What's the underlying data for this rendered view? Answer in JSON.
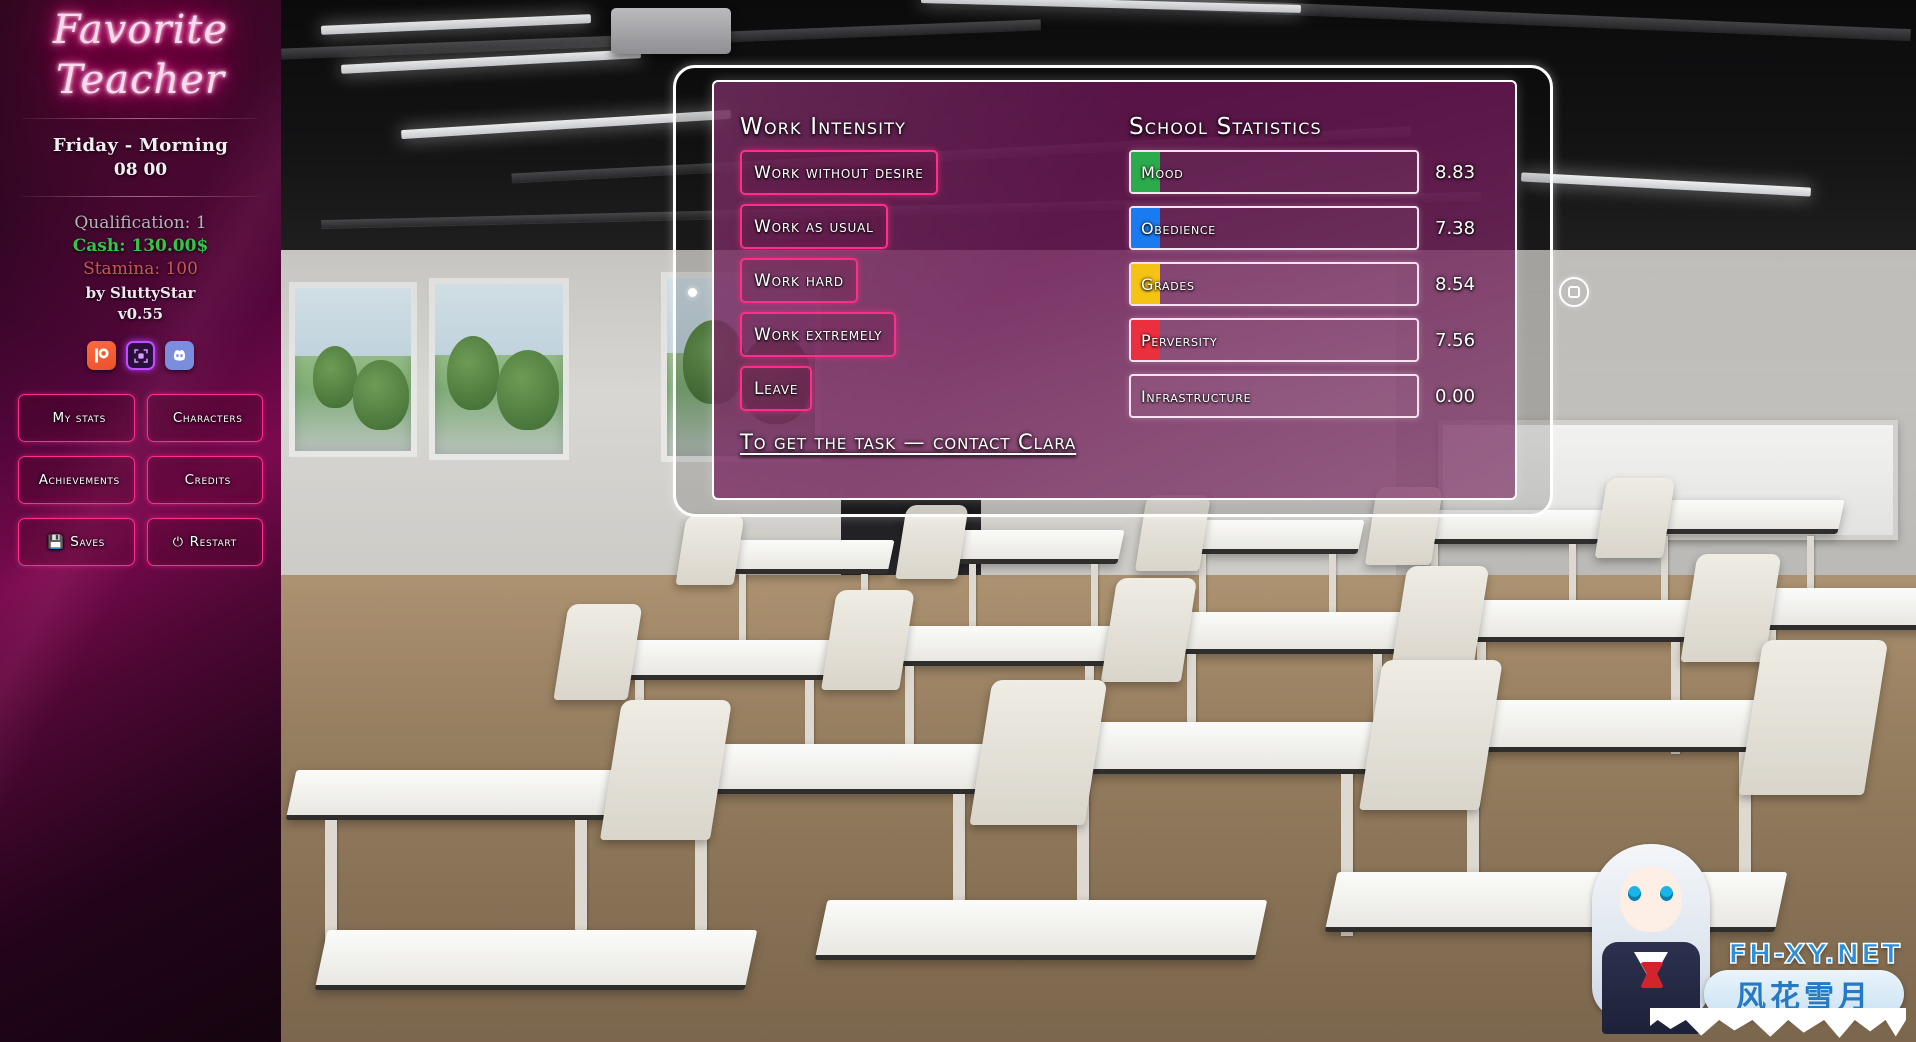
{
  "sidebar": {
    "title_line1": "Favorite",
    "title_line2": "Teacher",
    "day_phase": "Friday - Morning",
    "clock": "08 00",
    "qualification": "Qualification: 1",
    "cash": "Cash: 130.00$",
    "stamina": "Stamina: 100",
    "author": "by SluttyStar",
    "version": "v0.55",
    "social": [
      {
        "name": "patreon-icon",
        "glyph": "Ⓟ"
      },
      {
        "name": "subscribestar-icon",
        "glyph": "▣"
      },
      {
        "name": "discord-icon",
        "glyph": "◕"
      }
    ],
    "menu": [
      {
        "label": "My stats",
        "icon": ""
      },
      {
        "label": "Characters",
        "icon": ""
      },
      {
        "label": "Achievements",
        "icon": ""
      },
      {
        "label": "Credits",
        "icon": ""
      },
      {
        "label": "Saves",
        "icon": "💾"
      },
      {
        "label": "Restart",
        "icon": "⏻"
      }
    ]
  },
  "dialog": {
    "work": {
      "heading": "Work Intensity",
      "options": [
        "Work without desire",
        "Work as usual",
        "Work hard",
        "Work extremely",
        "Leave"
      ]
    },
    "stats": {
      "heading": "School Statistics",
      "rows": [
        {
          "label": "Mood",
          "value": "8.83",
          "color": "#2bab4b",
          "fill_pct": 10
        },
        {
          "label": "Obedience",
          "value": "7.38",
          "color": "#1a7bf0",
          "fill_pct": 10
        },
        {
          "label": "Grades",
          "value": "8.54",
          "color": "#f5c314",
          "fill_pct": 10
        },
        {
          "label": "Perversity",
          "value": "7.56",
          "color": "#ec2f3f",
          "fill_pct": 10
        },
        {
          "label": "Infrastructure",
          "value": "0.00",
          "color": "#ec2f3f",
          "fill_pct": 0
        }
      ]
    },
    "task_hint": "To get the task — contact Clara",
    "home_button_label": "home"
  },
  "watermark": {
    "site": "FH-XY.NET",
    "cn": "风花雪月"
  }
}
